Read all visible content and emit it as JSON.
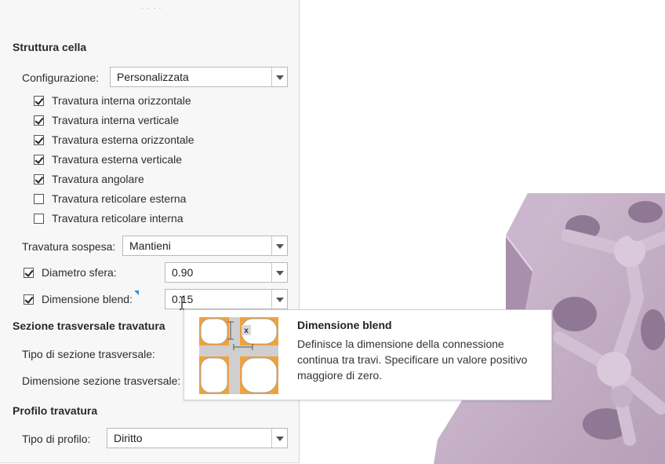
{
  "cell_structure": {
    "title": "Struttura cella",
    "configuration_label": "Configurazione:",
    "configuration_value": "Personalizzata",
    "trusses": [
      {
        "label": "Travatura interna orizzontale",
        "checked": true
      },
      {
        "label": "Travatura interna verticale",
        "checked": true
      },
      {
        "label": "Travatura esterna orizzontale",
        "checked": true
      },
      {
        "label": "Travatura esterna verticale",
        "checked": true
      },
      {
        "label": "Travatura angolare",
        "checked": true
      },
      {
        "label": "Travatura reticolare esterna",
        "checked": false
      },
      {
        "label": "Travatura reticolare interna",
        "checked": false
      }
    ],
    "suspended_label": "Travatura sospesa:",
    "suspended_value": "Mantieni",
    "sphere_diameter_label": "Diametro sfera:",
    "sphere_diameter_value": "0.90",
    "blend_size_label": "Dimensione blend:",
    "blend_size_value": "0.15"
  },
  "cross_section": {
    "title": "Sezione trasversale travatura",
    "type_label": "Tipo di sezione trasversale:",
    "size_label": "Dimensione sezione trasversale:"
  },
  "profile": {
    "title": "Profilo travatura",
    "type_label": "Tipo di profilo:",
    "type_value": "Diritto"
  },
  "tooltip": {
    "title": "Dimensione blend",
    "description": "Definisce la dimensione della connessione continua tra travi. Specificare un valore positivo maggiore di zero.",
    "thumb_label": "x"
  },
  "colors": {
    "model": "#c9b4cc",
    "thumb_orange": "#f0a23c",
    "accent": "#2f8fd6"
  }
}
